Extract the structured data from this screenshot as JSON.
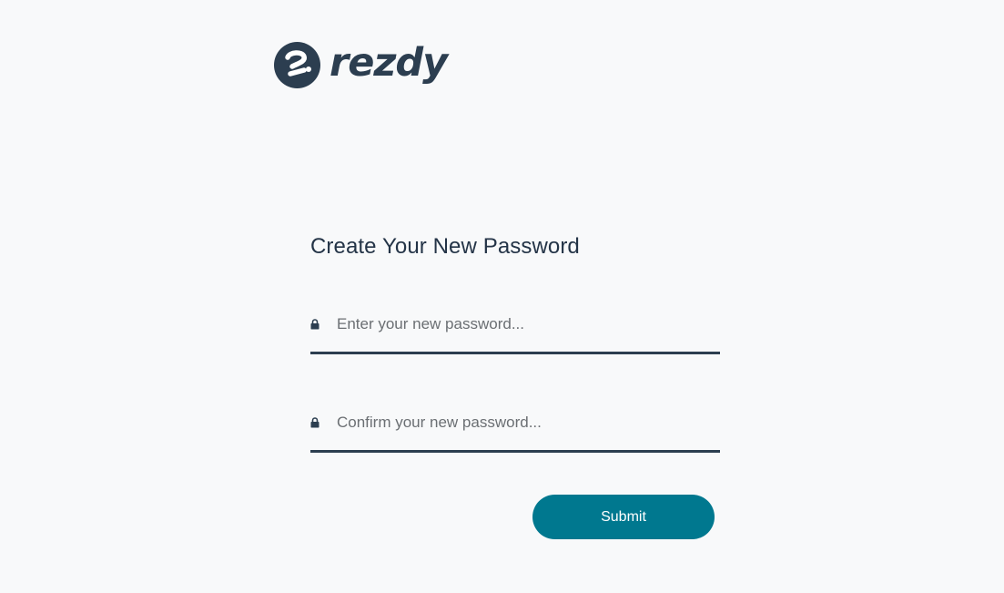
{
  "brand": {
    "name": "rezdy",
    "color": "#2c3e50"
  },
  "form": {
    "title": "Create Your New Password",
    "new_password": {
      "placeholder": "Enter your new password...",
      "icon": "lock-icon",
      "value": ""
    },
    "confirm_password": {
      "placeholder": "Confirm your new password...",
      "icon": "lock-icon",
      "value": ""
    },
    "submit_label": "Submit"
  },
  "colors": {
    "background": "#f8f9fa",
    "accent": "#00788f",
    "text_dark": "#243447"
  }
}
